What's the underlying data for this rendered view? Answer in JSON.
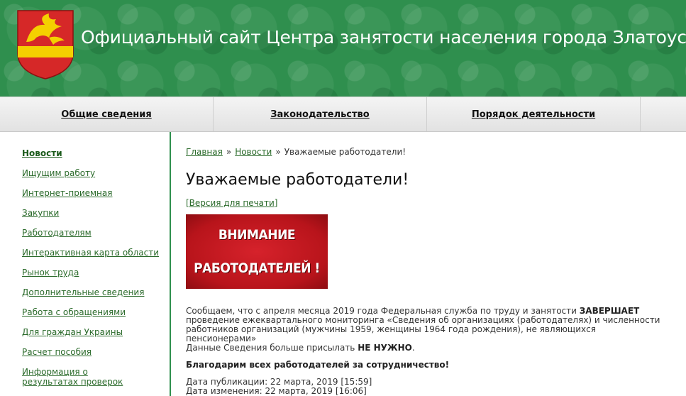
{
  "header": {
    "site_title": "Официальный сайт Центра занятости населения города Златоуста",
    "crest_colors": {
      "field": "#d62828",
      "band": "#f4d000",
      "bird": "#f4d000"
    }
  },
  "topnav": {
    "items": [
      {
        "label": "Общие сведения"
      },
      {
        "label": "Законодательство"
      },
      {
        "label": "Порядок деятельности"
      }
    ]
  },
  "sidebar": {
    "items": [
      {
        "label": "Новости",
        "active": true
      },
      {
        "label": "Ищущим работу"
      },
      {
        "label": "Интернет-приемная"
      },
      {
        "label": "Закупки"
      },
      {
        "label": "Работодателям"
      },
      {
        "label": "Интерактивная карта области"
      },
      {
        "label": "Рынок труда"
      },
      {
        "label": "Дополнительные сведения"
      },
      {
        "label": "Работа с обращениями"
      },
      {
        "label": "Для граждан Украины"
      },
      {
        "label": "Расчет пособия"
      },
      {
        "label": "Информация о результатах проверок"
      }
    ]
  },
  "breadcrumb": {
    "home": "Главная",
    "sep": "»",
    "section": "Новости",
    "current": "Уважаемые работодатели!"
  },
  "article": {
    "title": "Уважаемые работодатели!",
    "print_link": "[Версия для печати]",
    "banner_line1": "ВНИМАНИЕ",
    "banner_line2": "РАБОТОДАТЕЛЕЙ !",
    "p1_a": "Сообщаем, что с апреля месяца 2019 года Федеральная служба по труду и занятости ",
    "p1_bold": "ЗАВЕРШАЕТ",
    "p1_b": " проведение ежеквартального мониторинга «Сведения об организациях (работодателях) и численности работников организаций (мужчины 1959, женщины 1964 года рождения), не являющихся пенсионерами»",
    "p2_a": "Данные Сведения больше присылать ",
    "p2_bold": "НЕ НУЖНО",
    "p2_b": ".",
    "p3_bold": "Благодарим всех работодателей за сотрудничество!",
    "published": "Дата публикации: 22 марта, 2019 [15:59]",
    "modified": "Дата изменения: 22 марта, 2019 [16:06]"
  }
}
